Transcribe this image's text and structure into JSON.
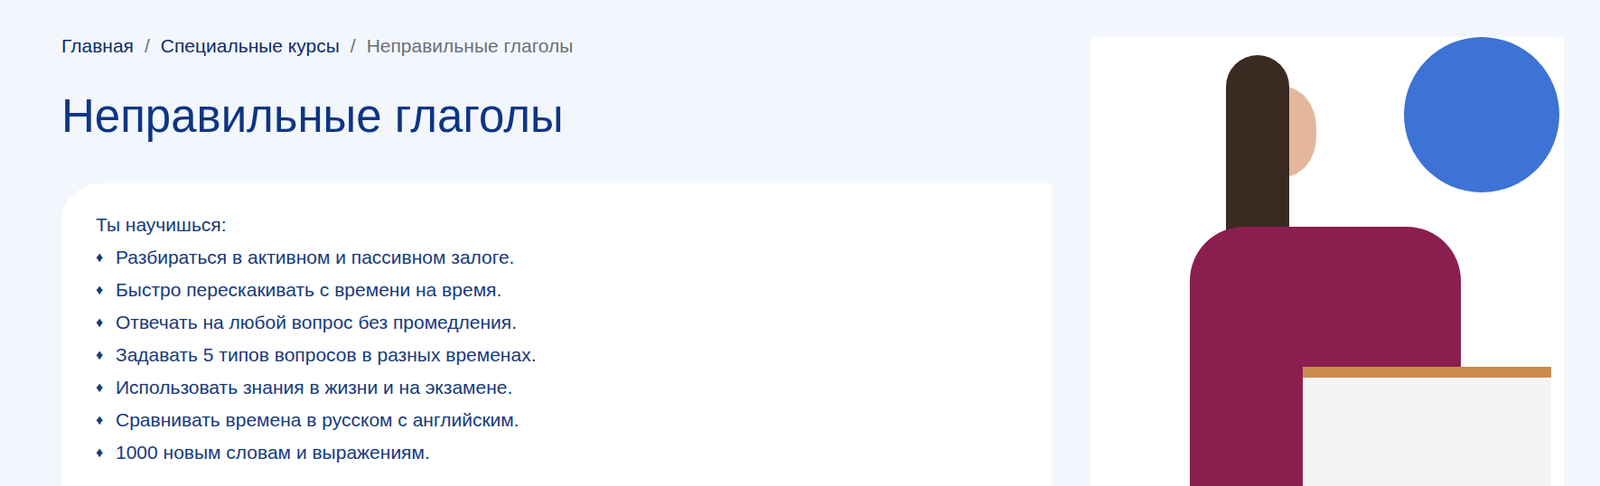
{
  "breadcrumbs": {
    "separator": "/",
    "items": [
      {
        "label": "Главная",
        "current": false
      },
      {
        "label": "Специальные курсы",
        "current": false
      },
      {
        "label": "Неправильные глаголы",
        "current": true
      }
    ]
  },
  "title": "Неправильные глаголы",
  "card": {
    "intro": "Ты научишься:",
    "bullet": "♦",
    "items": [
      "Разбираться в активном и пассивном залоге.",
      "Быстро перескакивать с времени на время.",
      "Отвечать на любой вопрос без промедления.",
      "Задавать 5 типов вопросов в разных временах.",
      "Использовать знания в жизни и на экзамене.",
      "Сравнивать времена в русском с английским.",
      "1000 новым словам и выражениям."
    ]
  }
}
